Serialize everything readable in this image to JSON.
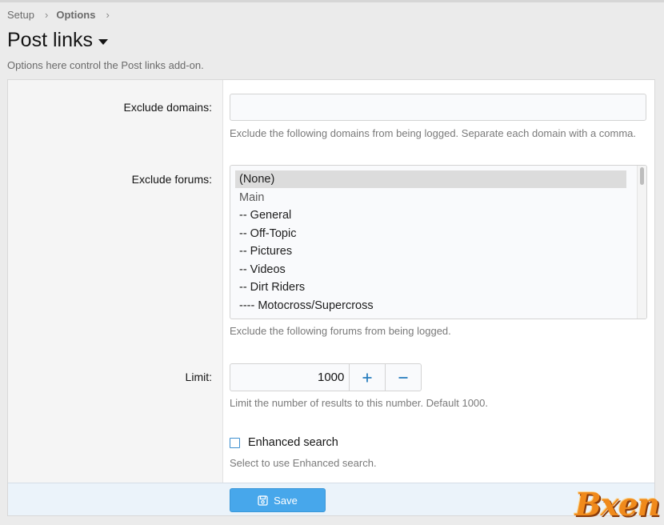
{
  "breadcrumb": {
    "items": [
      "Setup",
      "Options"
    ],
    "separator": "›"
  },
  "page": {
    "title": "Post links",
    "description": "Options here control the Post links add-on."
  },
  "options": {
    "exclude_domains": {
      "label": "Exclude domains:",
      "value": "",
      "hint": "Exclude the following domains from being logged. Separate each domain with a comma."
    },
    "exclude_forums": {
      "label": "Exclude forums:",
      "hint": "Exclude the following forums from being logged.",
      "items": [
        "(None)",
        "Main",
        "-- General",
        "-- Off-Topic",
        "-- Pictures",
        "-- Videos",
        "-- Dirt Riders",
        "---- Motocross/Supercross"
      ],
      "selected": "(None)"
    },
    "limit": {
      "label": "Limit:",
      "value": "1000",
      "hint": "Limit the number of results to this number. Default 1000."
    },
    "enhanced_search": {
      "label": "Enhanced search",
      "checked": false,
      "hint": "Select to use Enhanced search."
    }
  },
  "footer": {
    "save_label": "Save"
  },
  "watermark": {
    "text": "Bxen"
  },
  "colors": {
    "accent": "#47a7eb",
    "link_icon": "#2a7fbf",
    "watermark": "#f08a1c"
  }
}
